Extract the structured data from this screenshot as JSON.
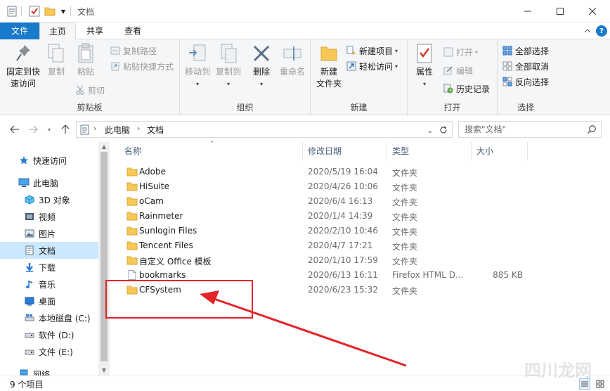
{
  "window": {
    "title": "文档"
  },
  "ribbon_tabs": [
    {
      "label": "文件"
    },
    {
      "label": "主页"
    },
    {
      "label": "共享"
    },
    {
      "label": "查看"
    }
  ],
  "ribbon": {
    "clipboard": {
      "label": "剪贴板",
      "pin_label_1": "固定到快",
      "pin_label_2": "速访问",
      "copy": "复制",
      "paste": "粘贴",
      "copy_path": "复制路径",
      "paste_shortcut": "粘贴快捷方式",
      "cut": "剪切"
    },
    "organize": {
      "label": "组织",
      "move_to": "移动到",
      "copy_to": "复制到",
      "delete": "删除",
      "rename": "重命名"
    },
    "new": {
      "label": "新建",
      "new_folder_1": "新建",
      "new_folder_2": "文件夹",
      "new_item": "新建项目",
      "easy_access": "轻松访问"
    },
    "open": {
      "label": "打开",
      "properties": "属性",
      "open": "打开",
      "edit": "编辑",
      "history": "历史记录"
    },
    "select": {
      "label": "选择",
      "select_all": "全部选择",
      "select_none": "全部取消",
      "invert": "反向选择"
    }
  },
  "address": {
    "crumbs": [
      "此电脑",
      "文档"
    ],
    "search_placeholder": "搜索\"文档\""
  },
  "nav_pane": [
    {
      "label": "快速访问",
      "icon": "star-icon"
    },
    {
      "label": "此电脑",
      "icon": "pc-icon"
    },
    {
      "label": "3D 对象",
      "icon": "cube-icon"
    },
    {
      "label": "视频",
      "icon": "video-icon"
    },
    {
      "label": "图片",
      "icon": "picture-icon"
    },
    {
      "label": "文档",
      "icon": "document-icon",
      "selected": true
    },
    {
      "label": "下载",
      "icon": "download-icon"
    },
    {
      "label": "音乐",
      "icon": "music-icon"
    },
    {
      "label": "桌面",
      "icon": "desktop-icon"
    },
    {
      "label": "本地磁盘 (C:)",
      "icon": "drive-icon"
    },
    {
      "label": "软件 (D:)",
      "icon": "drive-icon"
    },
    {
      "label": "文件 (E:)",
      "icon": "drive-icon"
    },
    {
      "label": "网络",
      "icon": "network-icon"
    }
  ],
  "columns": {
    "name": "名称",
    "date": "修改日期",
    "type": "类型",
    "size": "大小"
  },
  "files": [
    {
      "name": "Adobe",
      "date": "2020/5/19 16:04",
      "type": "文件夹",
      "size": "",
      "icon": "folder-icon"
    },
    {
      "name": "HiSuite",
      "date": "2020/4/26 10:06",
      "type": "文件夹",
      "size": "",
      "icon": "folder-icon"
    },
    {
      "name": "oCam",
      "date": "2020/6/4 16:13",
      "type": "文件夹",
      "size": "",
      "icon": "folder-icon"
    },
    {
      "name": "Rainmeter",
      "date": "2020/1/4 14:39",
      "type": "文件夹",
      "size": "",
      "icon": "folder-icon"
    },
    {
      "name": "Sunlogin Files",
      "date": "2020/2/10 10:46",
      "type": "文件夹",
      "size": "",
      "icon": "folder-icon"
    },
    {
      "name": "Tencent Files",
      "date": "2020/4/7 17:21",
      "type": "文件夹",
      "size": "",
      "icon": "folder-icon"
    },
    {
      "name": "自定义 Office 模板",
      "date": "2020/1/10 17:59",
      "type": "文件夹",
      "size": "",
      "icon": "folder-icon"
    },
    {
      "name": "bookmarks",
      "date": "2020/6/13 16:11",
      "type": "Firefox HTML D...",
      "size": "885 KB",
      "icon": "html-file-icon"
    },
    {
      "name": "CFSystem",
      "date": "2020/6/23 15:32",
      "type": "文件夹",
      "size": "",
      "icon": "folder-icon"
    }
  ],
  "status": {
    "count": "9 个项目"
  },
  "watermark": "四川龙网",
  "colors": {
    "accent": "#1979ca",
    "selection": "#cce8ff",
    "annotation": "#e2252b",
    "folder": "#f6c855"
  }
}
